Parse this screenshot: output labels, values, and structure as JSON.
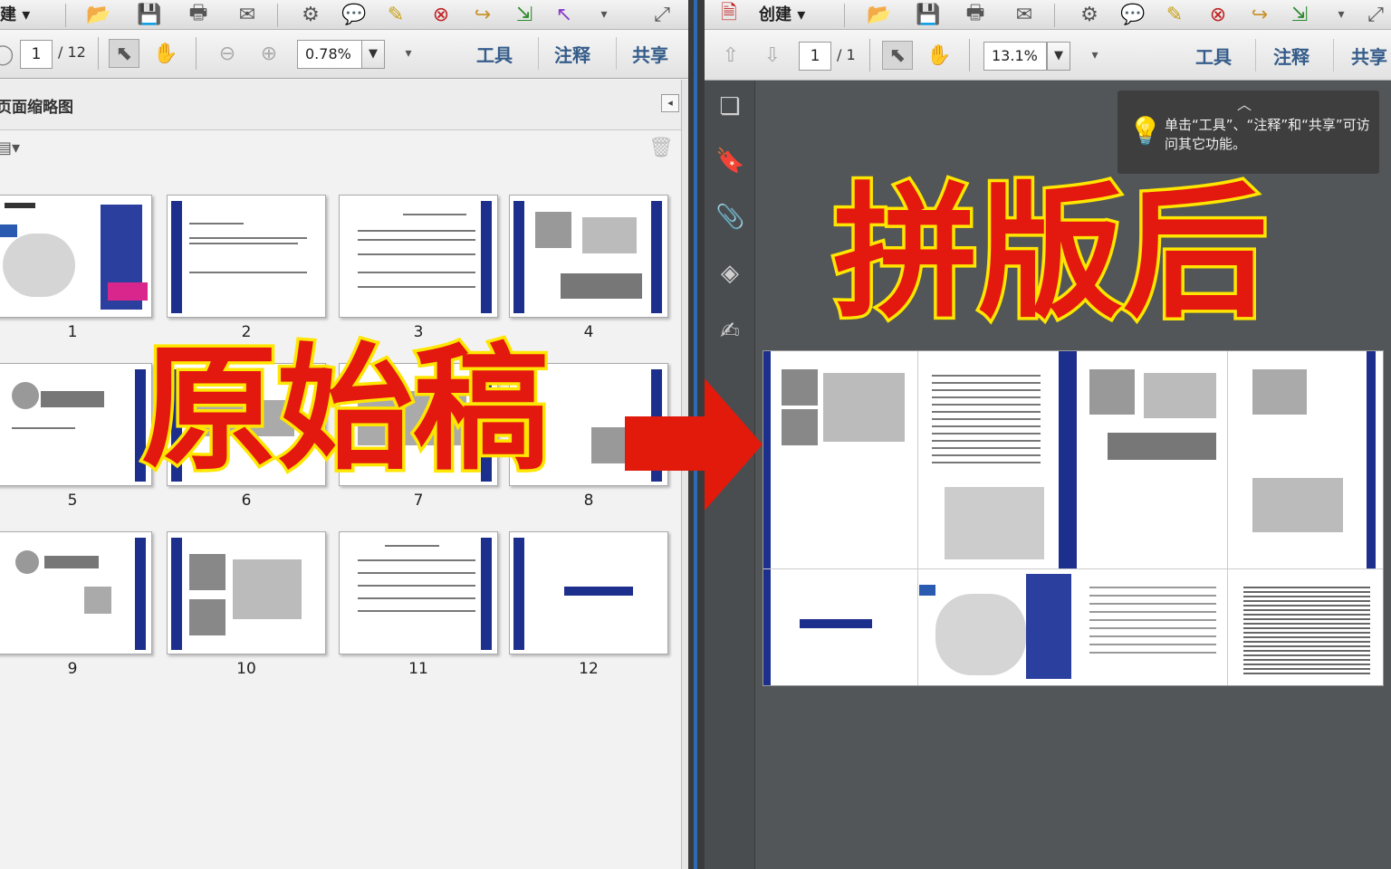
{
  "left": {
    "toolbar": {
      "create_label": "建",
      "page_current": "1",
      "page_total": "/ 12",
      "zoom": "0.78%"
    },
    "nav": {
      "tools": "工具",
      "comment": "注释",
      "share": "共享"
    },
    "panel": {
      "title": "页面缩略图",
      "trash_icon": "trash-icon",
      "options_icon": "options-icon"
    },
    "thumbnails": [
      {
        "label": "1"
      },
      {
        "label": "2"
      },
      {
        "label": "3"
      },
      {
        "label": "4"
      },
      {
        "label": "5"
      },
      {
        "label": "6"
      },
      {
        "label": "7"
      },
      {
        "label": "8"
      },
      {
        "label": "9"
      },
      {
        "label": "10"
      },
      {
        "label": "11"
      },
      {
        "label": "12"
      }
    ]
  },
  "right": {
    "toolbar": {
      "create_label": "创建",
      "page_current": "1",
      "page_total": "/ 1",
      "zoom": "13.1%"
    },
    "nav": {
      "tools": "工具",
      "comment": "注释",
      "share": "共享"
    },
    "tooltip": {
      "text": "单击“工具”、“注释”和“共享”可访问其它功能。"
    }
  },
  "overlay": {
    "original_label": "原始稿",
    "after_label": "拼版后",
    "arrow_color": "#e11a0c",
    "text_color": "#e3180f",
    "outline_color": "#ffe600"
  }
}
